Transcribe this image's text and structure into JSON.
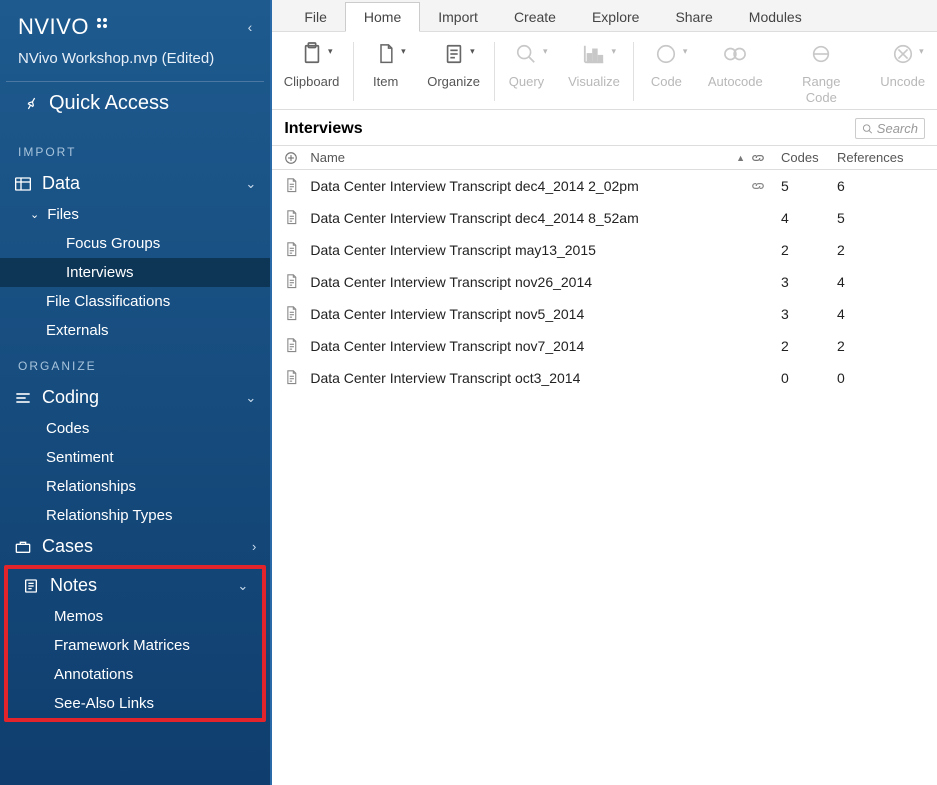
{
  "app": {
    "logo": "NVIVO",
    "project": "NVivo Workshop.nvp (Edited)"
  },
  "quick_access": {
    "label": "Quick Access"
  },
  "sections": {
    "import": "IMPORT",
    "organize": "ORGANIZE"
  },
  "nav": {
    "data": {
      "label": "Data",
      "files": {
        "label": "Files",
        "children": [
          "Focus Groups",
          "Interviews"
        ]
      },
      "file_classifications": "File Classifications",
      "externals": "Externals"
    },
    "coding": {
      "label": "Coding",
      "children": [
        "Codes",
        "Sentiment",
        "Relationships",
        "Relationship Types"
      ]
    },
    "cases": {
      "label": "Cases"
    },
    "notes": {
      "label": "Notes",
      "children": [
        "Memos",
        "Framework Matrices",
        "Annotations",
        "See-Also Links"
      ]
    }
  },
  "tabs": [
    "File",
    "Home",
    "Import",
    "Create",
    "Explore",
    "Share",
    "Modules"
  ],
  "active_tab": "Home",
  "ribbon": {
    "clipboard": "Clipboard",
    "item": "Item",
    "organize": "Organize",
    "query": "Query",
    "visualize": "Visualize",
    "code": "Code",
    "autocode": "Autocode",
    "range_code": "Range Code",
    "uncode": "Uncode"
  },
  "list": {
    "title": "Interviews",
    "search_placeholder": "Search",
    "columns": {
      "name": "Name",
      "codes": "Codes",
      "references": "References"
    },
    "rows": [
      {
        "name": "Data Center Interview Transcript dec4_2014 2_02pm",
        "link": true,
        "codes": 5,
        "refs": 6
      },
      {
        "name": "Data Center Interview Transcript dec4_2014 8_52am",
        "link": false,
        "codes": 4,
        "refs": 5
      },
      {
        "name": "Data Center Interview Transcript may13_2015",
        "link": false,
        "codes": 2,
        "refs": 2
      },
      {
        "name": "Data Center Interview Transcript nov26_2014",
        "link": false,
        "codes": 3,
        "refs": 4
      },
      {
        "name": "Data Center Interview Transcript nov5_2014",
        "link": false,
        "codes": 3,
        "refs": 4
      },
      {
        "name": "Data Center Interview Transcript nov7_2014",
        "link": false,
        "codes": 2,
        "refs": 2
      },
      {
        "name": "Data Center Interview Transcript oct3_2014",
        "link": false,
        "codes": 0,
        "refs": 0
      }
    ]
  }
}
